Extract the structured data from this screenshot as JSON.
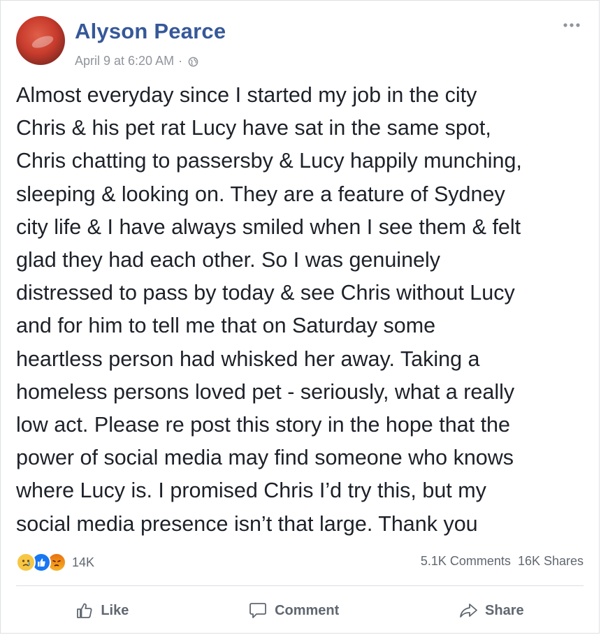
{
  "post": {
    "author": "Alyson Pearce",
    "timestamp": "April 9 at 6:20 AM",
    "separator": "·",
    "privacy_icon": "globe-icon",
    "more_icon": "more-horizontal-icon",
    "text_lines": [
      "Almost everyday since I started my job in the city",
      "Chris & his pet rat Lucy have sat in the same spot,",
      "Chris chatting to passersby & Lucy happily munching,",
      "sleeping & looking on. They are a feature of Sydney",
      "city life & I have always smiled when I see them & felt",
      "glad they had each other. So I was genuinely",
      "distressed to pass by today & see Chris without Lucy",
      "and for him to tell me that on Saturday some",
      "heartless person had whisked her away. Taking a",
      "homeless persons loved pet - seriously, what a really",
      "low act. Please re post this story in the hope that the",
      "power of social media may find someone who knows",
      "where Lucy is. I promised Chris I’d try this, but my",
      "social media presence isn’t that large. Thank you"
    ]
  },
  "reactions": {
    "icons": [
      "sad-reaction-icon",
      "like-reaction-icon",
      "angry-reaction-icon"
    ],
    "count": "14K"
  },
  "stats": {
    "comments": "5.1K Comments",
    "shares": "16K Shares"
  },
  "actions": {
    "like": "Like",
    "comment": "Comment",
    "share": "Share"
  },
  "colors": {
    "author": "#365899",
    "text": "#1d2129",
    "meta": "#90949c",
    "action": "#606770"
  }
}
